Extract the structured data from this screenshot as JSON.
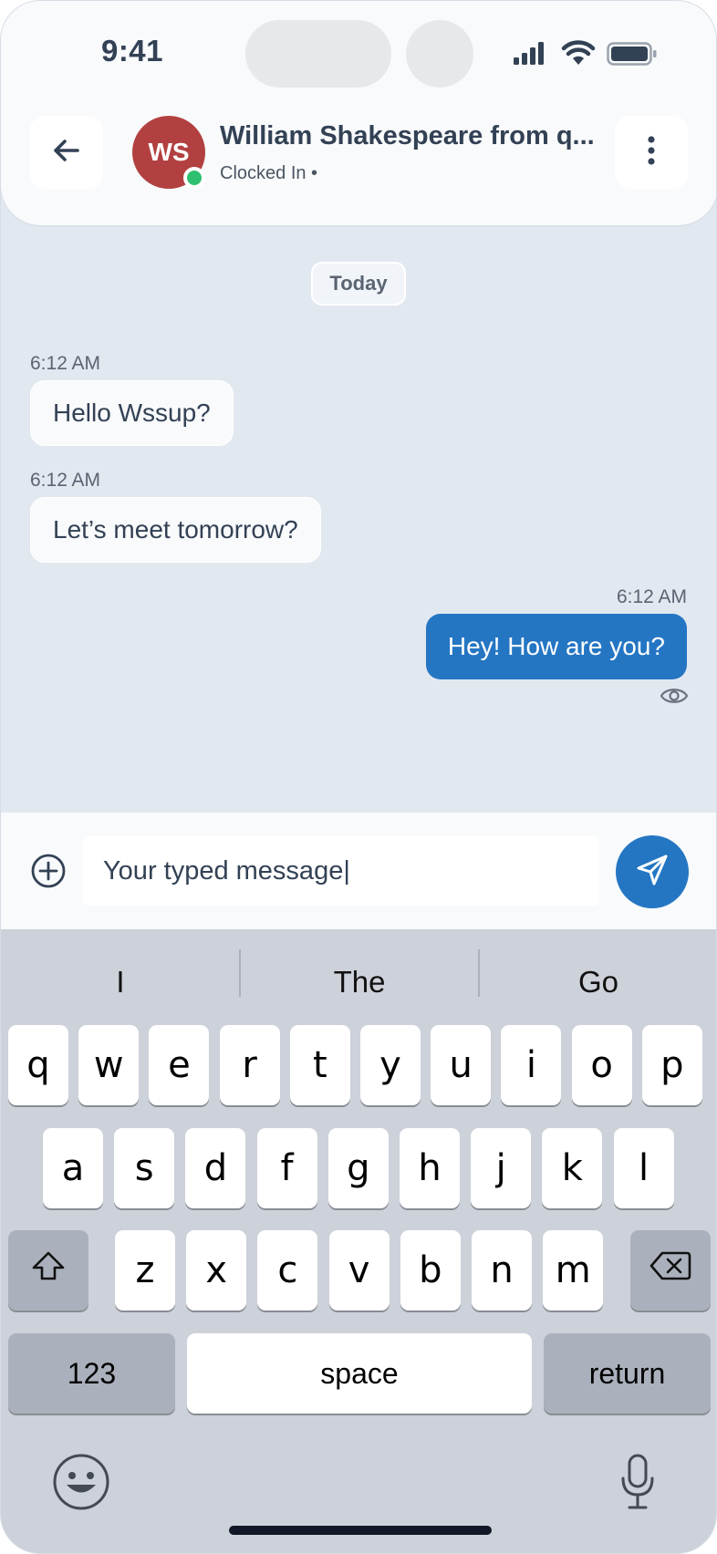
{
  "status_bar": {
    "time": "9:41"
  },
  "header": {
    "back_icon": "arrow-left-icon",
    "avatar_initials": "WS",
    "contact_name": "William Shakespeare from q...",
    "contact_status": "Clocked In •",
    "menu_icon": "more-vertical-icon",
    "online_color": "#2fbf71"
  },
  "chat": {
    "date_label": "Today",
    "messages": [
      {
        "direction": "incoming",
        "time": "6:12 AM",
        "text": "Hello Wssup?"
      },
      {
        "direction": "incoming",
        "time": "6:12 AM",
        "text": "Let’s meet tomorrow?"
      },
      {
        "direction": "outgoing",
        "time": "6:12 AM",
        "text": "Hey! How are you?"
      }
    ],
    "seen_icon": "eye-icon"
  },
  "composer": {
    "attach_icon": "plus-circle-icon",
    "input_value": "Your typed message|",
    "send_icon": "send-icon",
    "accent_color": "#2476c3"
  },
  "keyboard": {
    "suggestions": [
      "I",
      "The",
      "Go"
    ],
    "row1": [
      "q",
      "w",
      "e",
      "r",
      "t",
      "y",
      "u",
      "i",
      "o",
      "p"
    ],
    "row2": [
      "a",
      "s",
      "d",
      "f",
      "g",
      "h",
      "j",
      "k",
      "l"
    ],
    "row3": [
      "z",
      "x",
      "c",
      "v",
      "b",
      "n",
      "m"
    ],
    "numbers_label": "123",
    "space_label": "space",
    "return_label": "return",
    "shift_icon": "shift-icon",
    "delete_icon": "backspace-icon",
    "emoji_icon": "emoji-icon",
    "mic_icon": "microphone-icon"
  }
}
